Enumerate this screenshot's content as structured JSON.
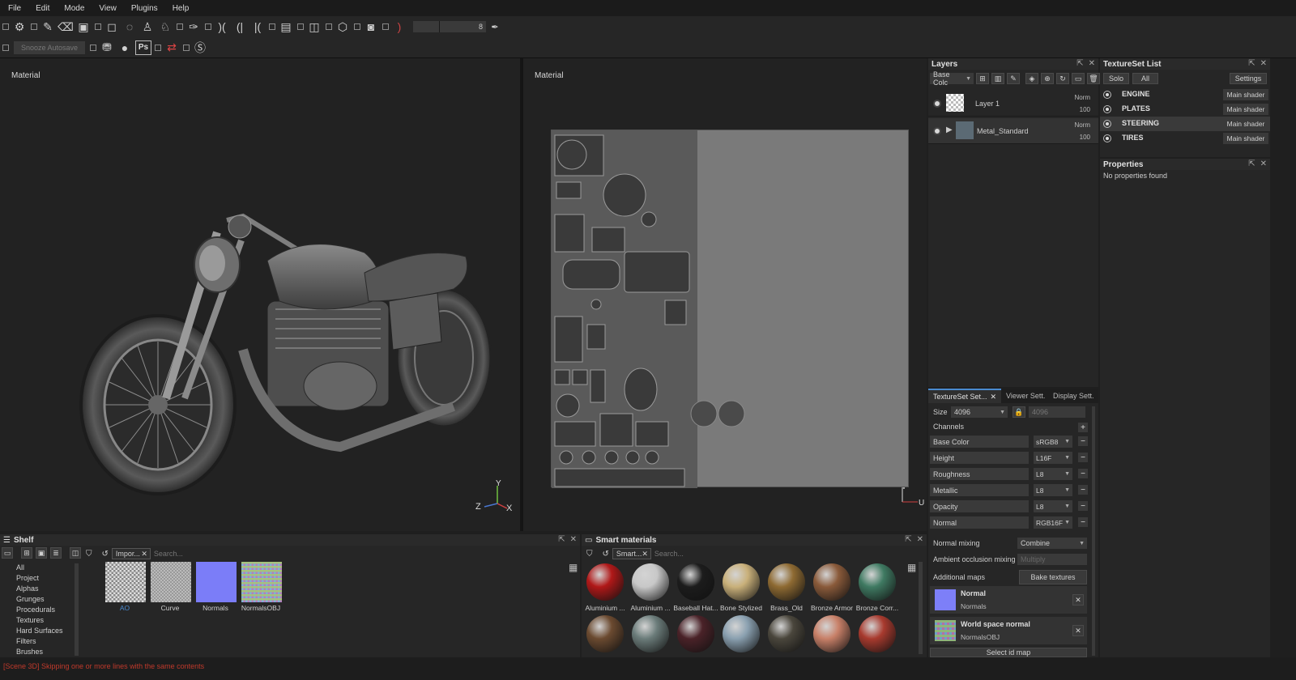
{
  "menu": [
    "File",
    "Edit",
    "Mode",
    "View",
    "Plugins",
    "Help"
  ],
  "toolbar": {
    "brush_size": "8",
    "snooze_label": "Snooze Autosave",
    "ps_label": "Ps"
  },
  "viewports": {
    "left_title": "Material",
    "right_title": "Material",
    "axis_y": "Y",
    "axis_z": "Z",
    "axis_x": "X",
    "uv_v": "V",
    "uv_u": "U"
  },
  "layers": {
    "title": "Layers",
    "channel_select": "Base Colc",
    "items": [
      {
        "name": "Layer 1",
        "blend": "Norm",
        "opacity": "100"
      },
      {
        "name": "Metal_Standard",
        "blend": "Norm",
        "opacity": "100"
      }
    ]
  },
  "texture_set_list": {
    "title": "TextureSet List",
    "solo": "Solo",
    "all": "All",
    "settings": "Settings",
    "items": [
      {
        "name": "ENGINE",
        "shader": "Main shader"
      },
      {
        "name": "PLATES",
        "shader": "Main shader"
      },
      {
        "name": "STEERING",
        "shader": "Main shader"
      },
      {
        "name": "TIRES",
        "shader": "Main shader"
      }
    ]
  },
  "properties": {
    "title": "Properties",
    "empty_text": "No properties found"
  },
  "texture_set_settings": {
    "tabs": [
      "TextureSet Set...",
      "Viewer Sett.",
      "Display Sett."
    ],
    "size_label": "Size",
    "size_value": "4096",
    "size_value_2": "4096",
    "channels_label": "Channels",
    "channels": [
      {
        "name": "Base Color",
        "format": "sRGB8"
      },
      {
        "name": "Height",
        "format": "L16F"
      },
      {
        "name": "Roughness",
        "format": "L8"
      },
      {
        "name": "Metallic",
        "format": "L8"
      },
      {
        "name": "Opacity",
        "format": "L8"
      },
      {
        "name": "Normal",
        "format": "RGB16F"
      }
    ],
    "normal_mixing_label": "Normal mixing",
    "normal_mixing_value": "Combine",
    "ao_mixing_label": "Ambient occlusion mixing",
    "ao_mixing_value": "Multiply",
    "additional_maps_label": "Additional maps",
    "bake_button": "Bake textures",
    "maps": [
      {
        "title": "Normal",
        "subtitle": "Normals"
      },
      {
        "title": "World space normal",
        "subtitle": "NormalsOBJ"
      }
    ],
    "select_id_map": "Select id map"
  },
  "shelf": {
    "title": "Shelf",
    "filter_tag": "Impor...",
    "search_placeholder": "Search...",
    "categories": [
      "All",
      "Project",
      "Alphas",
      "Grunges",
      "Procedurals",
      "Textures",
      "Hard Surfaces",
      "Filters",
      "Brushes"
    ],
    "items": [
      "AO",
      "Curve",
      "Normals",
      "NormalsOBJ"
    ]
  },
  "smart_materials": {
    "title": "Smart materials",
    "filter_tag": "Smart...",
    "search_placeholder": "Search...",
    "items": [
      {
        "name": "Aluminium ...",
        "color": "#b01818"
      },
      {
        "name": "Aluminium ...",
        "color": "#c8c8c8"
      },
      {
        "name": "Baseball Hat...",
        "color": "#1c1c1c"
      },
      {
        "name": "Bone Stylized",
        "color": "#c9b07a"
      },
      {
        "name": "Brass_Old",
        "color": "#8e6a32"
      },
      {
        "name": "Bronze Armor",
        "color": "#8a5a3a"
      },
      {
        "name": "Bronze Corr...",
        "color": "#3f7a62"
      }
    ],
    "row2_colors": [
      "#6b4a30",
      "#6b7c7a",
      "#4a2228",
      "#8aa0b0",
      "#4a463c",
      "#c88068",
      "#a83a2e"
    ]
  },
  "status": {
    "message": "[Scene 3D] Skipping one or more lines with the same contents"
  }
}
